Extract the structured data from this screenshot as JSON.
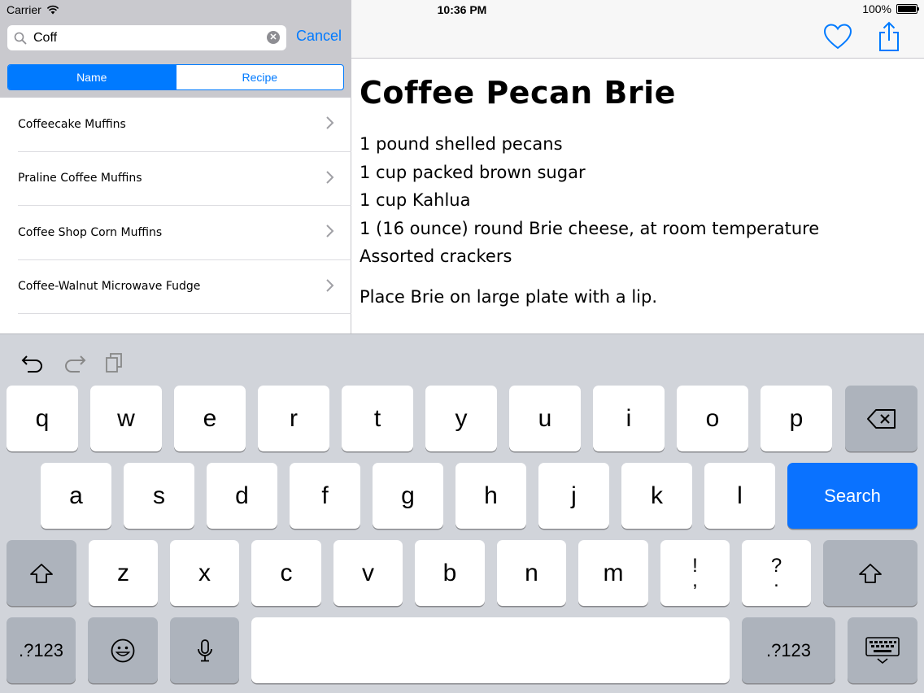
{
  "status_bar": {
    "carrier": "Carrier",
    "time": "10:36 PM",
    "battery": "100%"
  },
  "search": {
    "value": "Coff",
    "cancel_label": "Cancel"
  },
  "segments": [
    {
      "label": "Name",
      "active": true
    },
    {
      "label": "Recipe",
      "active": false
    }
  ],
  "recipe_list": [
    "Coffeecake Muffins",
    "Praline Coffee Muffins",
    "Coffee Shop Corn Muffins",
    "Coffee-Walnut Microwave Fudge"
  ],
  "recipe": {
    "title": "Coffee Pecan Brie",
    "ingredients": [
      "1 pound shelled pecans",
      "1 cup packed brown sugar",
      "1 cup Kahlua",
      "1 (16 ounce) round Brie cheese, at room temperature",
      "Assorted crackers"
    ],
    "instructions": "Place Brie on large plate with a lip."
  },
  "keyboard": {
    "row1": [
      "q",
      "w",
      "e",
      "r",
      "t",
      "y",
      "u",
      "i",
      "o",
      "p"
    ],
    "row2": [
      "a",
      "s",
      "d",
      "f",
      "g",
      "h",
      "j",
      "k",
      "l"
    ],
    "row3": [
      "z",
      "x",
      "c",
      "v",
      "b",
      "n",
      "m"
    ],
    "exclaim_top": "!",
    "exclaim_bottom": ",",
    "question_top": "?",
    "question_bottom": ".",
    "search_label": "Search",
    "numbers_label": ".?123"
  },
  "icons": {
    "undo": "undo-icon",
    "redo": "redo-icon",
    "paste": "paste-icon",
    "heart": "heart-icon",
    "share": "share-icon",
    "backspace": "backspace-icon",
    "shift": "shift-icon",
    "emoji": "emoji-icon",
    "mic": "microphone-icon",
    "hide_keyboard": "hide-keyboard-icon"
  },
  "colors": {
    "accent": "#007aff",
    "search_key": "#0a72ff",
    "keyboard_bg": "#d1d4da"
  }
}
